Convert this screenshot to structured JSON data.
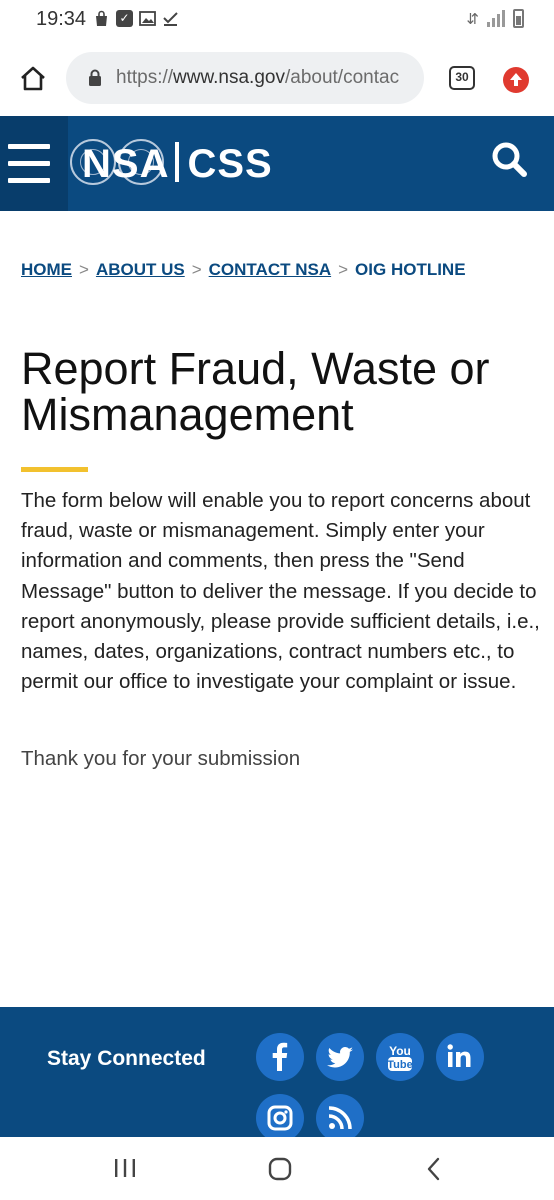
{
  "status_bar": {
    "time": "19:34",
    "icons": [
      "bag-icon",
      "checkbox-icon",
      "image-icon",
      "download-done-icon"
    ],
    "right_icons": [
      "data-transfer-icon",
      "signal-icon",
      "battery-icon"
    ]
  },
  "browser": {
    "url_prefix": "https://",
    "url_host": "www.nsa.gov",
    "url_path": "/about/contac",
    "tab_count": "30",
    "accent_color": "#e03a2f"
  },
  "site": {
    "logo_left": "NSA",
    "logo_right": "CSS",
    "header_color": "#0b4a80"
  },
  "breadcrumb": {
    "items": [
      "HOME",
      "ABOUT US",
      "CONTACT NSA"
    ],
    "current": "OIG HOTLINE"
  },
  "page": {
    "title": "Report Fraud, Waste or Mismanagement",
    "intro": "The form below will enable you to report concerns about fraud, waste or mismanagement. Simply enter your information and comments, then press the \"Send Message\" button to deliver the message. If you decide to report anonymously, please provide sufficient details, i.e., names, dates, organizations, contract numbers etc., to permit our office to investigate your complaint or issue.",
    "thanks": "Thank you for your submission",
    "accent_color": "#f2c12e"
  },
  "footer": {
    "stay_connected": "Stay Connected",
    "social": [
      "facebook-icon",
      "twitter-icon",
      "youtube-icon",
      "linkedin-icon",
      "instagram-icon",
      "rss-icon"
    ],
    "youtube_top": "You",
    "youtube_bottom": "Tube"
  },
  "nav_bar": [
    "recent-apps-icon",
    "home-icon",
    "back-icon"
  ]
}
